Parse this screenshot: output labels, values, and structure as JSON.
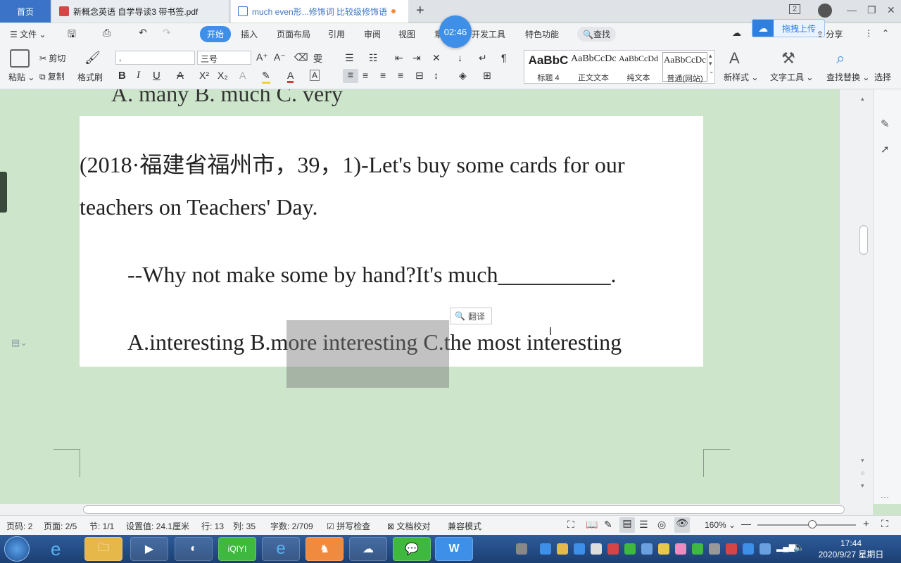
{
  "tabs": {
    "home": "首页",
    "pdf": "新概念英语 自学导读3 带书签.pdf",
    "doc": "much even形...修饰词 比较级修饰语"
  },
  "timer": "02:46",
  "tabbar_right": {
    "badge": "2"
  },
  "menu": {
    "file": "文件",
    "items": [
      "开始",
      "插入",
      "页面布局",
      "引用",
      "审阅",
      "视图",
      "章",
      "开发工具",
      "特色功能"
    ],
    "search": "查找",
    "upload": "拖拽上传",
    "unsaved": "有修改",
    "share": "分享"
  },
  "ribbon": {
    "paste": "粘贴",
    "cut": "剪切",
    "copy": "复制",
    "format_painter": "格式刷",
    "font_name": ",",
    "font_size": "三号",
    "styles": [
      {
        "preview": "AaBbC",
        "label": "标题 4"
      },
      {
        "preview": "AaBbCcDc",
        "label": "正文文本"
      },
      {
        "preview": "AaBbCcDd",
        "label": "纯文本"
      },
      {
        "preview": "AaBbCcDc",
        "label": "普通(网站)"
      }
    ],
    "new_style": "新样式",
    "text_tools": "文字工具",
    "find_replace": "查找替换",
    "select": "选择"
  },
  "document": {
    "prev_options": "A. many                    B. much                   C. very",
    "line1": "(2018·福建省福州市，39，1)-Let's  buy  some  cards  for  our",
    "line2": "teachers  on  Teachers'  Day.",
    "line3": "--Why  not  make  some  by  hand?It's  much__________.",
    "line4": "A.interesting  B.more  interesting  C.the  most  interesting",
    "translate": "翻译"
  },
  "status": {
    "page": "页码: 2",
    "pages": "页面: 2/5",
    "section": "节: 1/1",
    "setting": "设置值: 24.1厘米",
    "row": "行: 13",
    "col": "列: 35",
    "words": "字数: 2/709",
    "spell": "拼写检查",
    "proof": "文档校对",
    "compat": "兼容模式",
    "zoom": "160%"
  },
  "taskbar": {
    "time": "17:44",
    "date": "2020/9/27 星期日"
  }
}
